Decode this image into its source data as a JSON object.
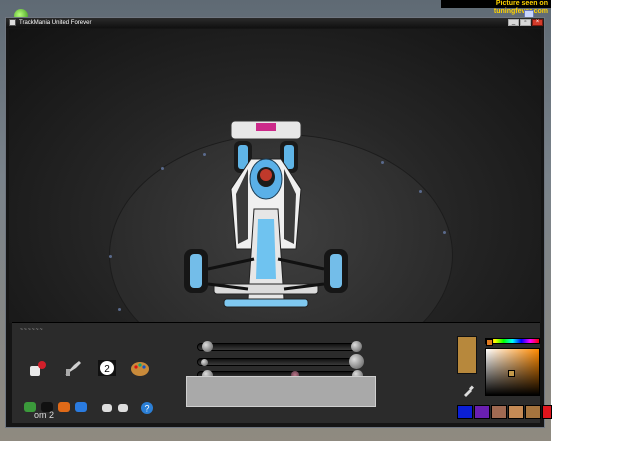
{
  "watermark": "Picture seen on tuningfever.com",
  "window": {
    "title": "TrackMania United Forever",
    "controls": [
      "_",
      "▫",
      "×"
    ]
  },
  "editor": {
    "panel_label": "~~~~~~",
    "layer_name": "om 2",
    "current_color": "#b7883c",
    "palette": [
      "#0b1fd6",
      "#6a1fb0",
      "#a06a52",
      "#c48a55",
      "#a5743e",
      "#e0141c"
    ]
  }
}
